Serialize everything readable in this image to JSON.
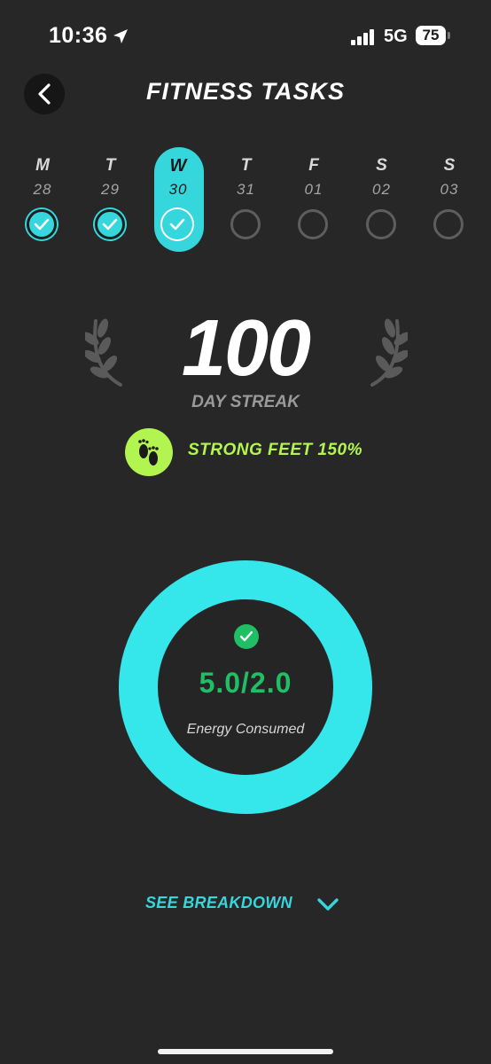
{
  "status_bar": {
    "time": "10:36",
    "network": "5G",
    "battery": "75"
  },
  "header": {
    "title": "FITNESS TASKS"
  },
  "week": [
    {
      "letter": "M",
      "date": "28",
      "done": true,
      "selected": false
    },
    {
      "letter": "T",
      "date": "29",
      "done": true,
      "selected": false
    },
    {
      "letter": "W",
      "date": "30",
      "done": true,
      "selected": true
    },
    {
      "letter": "T",
      "date": "31",
      "done": false,
      "selected": false
    },
    {
      "letter": "F",
      "date": "01",
      "done": false,
      "selected": false
    },
    {
      "letter": "S",
      "date": "02",
      "done": false,
      "selected": false
    },
    {
      "letter": "S",
      "date": "03",
      "done": false,
      "selected": false
    }
  ],
  "streak": {
    "number": "100",
    "label": "DAY STREAK"
  },
  "badge": {
    "icon": "feet-icon",
    "label": "STRONG FEET 150%"
  },
  "energy": {
    "value": "5.0/2.0",
    "label": "Energy Consumed",
    "progress_fraction": 1.0
  },
  "breakdown": {
    "label": "SEE BREAKDOWN"
  },
  "colors": {
    "background": "#272727",
    "accent": "#35d6dc",
    "ring": "#35e6ea",
    "success": "#1fbf66",
    "badge": "#b3f550"
  }
}
